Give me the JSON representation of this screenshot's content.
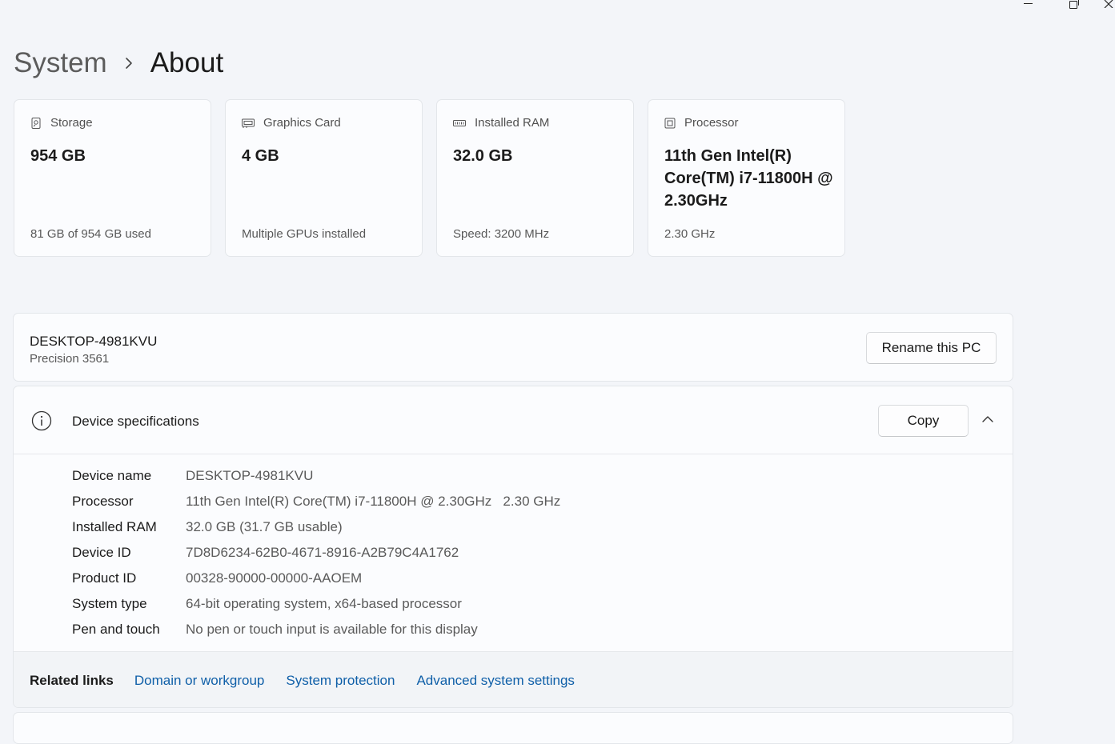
{
  "breadcrumb": {
    "parent": "System",
    "current": "About"
  },
  "cards": [
    {
      "title": "Storage",
      "value": "954 GB",
      "footer": "81 GB of 954 GB used",
      "icon": "storage-icon"
    },
    {
      "title": "Graphics Card",
      "value": "4 GB",
      "footer": "Multiple GPUs installed",
      "icon": "graphics-card-icon"
    },
    {
      "title": "Installed RAM",
      "value": "32.0 GB",
      "footer": "Speed: 3200 MHz",
      "icon": "ram-icon"
    },
    {
      "title": "Processor",
      "value": "11th Gen Intel(R) Core(TM) i7-11800H @ 2.30GHz",
      "footer": "2.30 GHz",
      "icon": "processor-icon"
    }
  ],
  "pc": {
    "name": "DESKTOP-4981KVU",
    "model": "Precision 3561",
    "rename_label": "Rename this PC"
  },
  "specs": {
    "title": "Device specifications",
    "copy_label": "Copy",
    "rows": [
      {
        "label": "Device name",
        "value": "DESKTOP-4981KVU"
      },
      {
        "label": "Processor",
        "value": "11th Gen Intel(R) Core(TM) i7-11800H @ 2.30GHz   2.30 GHz"
      },
      {
        "label": "Installed RAM",
        "value": "32.0 GB (31.7 GB usable)"
      },
      {
        "label": "Device ID",
        "value": "7D8D6234-62B0-4671-8916-A2B79C4A1762"
      },
      {
        "label": "Product ID",
        "value": "00328-90000-00000-AAOEM"
      },
      {
        "label": "System type",
        "value": "64-bit operating system, x64-based processor"
      },
      {
        "label": "Pen and touch",
        "value": "No pen or touch input is available for this display"
      }
    ]
  },
  "related": {
    "label": "Related links",
    "links": [
      "Domain or workgroup",
      "System protection",
      "Advanced system settings"
    ]
  },
  "colors": {
    "background": "#f3f5f9",
    "card": "#fbfcfe",
    "link": "#0f5fa8"
  }
}
